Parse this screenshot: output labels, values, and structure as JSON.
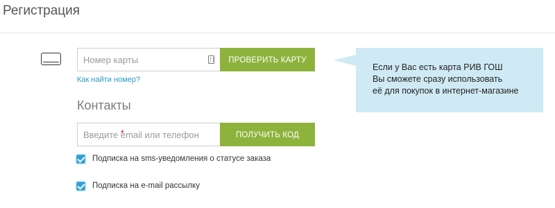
{
  "page": {
    "title": "Регистрация"
  },
  "card": {
    "icon": "credit-card-icon",
    "input_placeholder": "Номер карты",
    "input_value": "",
    "keypad_icon": "keypad-icon",
    "check_button_label": "ПРОВЕРИТЬ КАРТУ",
    "find_link_label": "Как найти номер?"
  },
  "tooltip": {
    "lines": [
      "Если у Вас есть карта РИВ ГОШ",
      "Вы сможете сразу использовать",
      "её для покупок в интернет-магазине"
    ]
  },
  "contacts": {
    "section_title": "Контакты",
    "input_placeholder": "Введите email или телефон",
    "input_value": "",
    "required_mark": "*",
    "get_code_button_label": "ПОЛУЧИТЬ КОД"
  },
  "subscriptions": [
    {
      "label": "Подписка на sms-уведомления о статусе заказа",
      "checked": true
    },
    {
      "label": "Подписка на e-mail рассылку",
      "checked": true
    }
  ],
  "colors": {
    "accent_green": "#8eb33d",
    "link_blue": "#2a9ac9",
    "tooltip_bg": "#cfeaf4",
    "checkbox_blue": "#2fa0d6",
    "required_red": "#d0021b"
  }
}
